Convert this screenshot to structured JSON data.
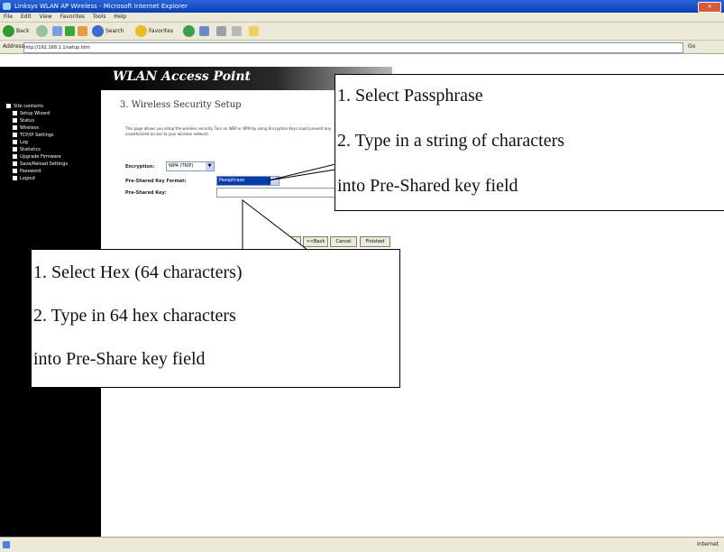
{
  "window": {
    "title": "Linksys WLAN AP Wireless - Microsoft Internet Explorer"
  },
  "menu": {
    "items": [
      "File",
      "Edit",
      "View",
      "Favorites",
      "Tools",
      "Help"
    ]
  },
  "toolbar": {
    "back": "Back",
    "search": "Search",
    "favorites": "Favorites"
  },
  "address": {
    "label": "Address",
    "url": "http://192.168.1.1/setup.htm",
    "go": "Go"
  },
  "header": {
    "title": "WLAN Access Point"
  },
  "nav": {
    "root": "Site contents",
    "items": [
      "Setup Wizard",
      "Status",
      "Wireless",
      "TCP/IP Settings",
      "Log",
      "Statistics",
      "Upgrade Firmware",
      "Save/Reload Settings",
      "Password",
      "Logout"
    ]
  },
  "section": {
    "title": "3. Wireless Security Setup"
  },
  "description": "This page allows you setup the wireless security. Turn on WEP or WPA by using Encryption Keys could prevent any unauthorized access to your wireless network.",
  "form": {
    "encryption_label": "Encryption:",
    "encryption_value": "WPA (TKIP)",
    "psk_format_label": "Pre-Shared Key Format:",
    "psk_format_value": "Passphrase",
    "psk_label": "Pre-Shared Key:"
  },
  "buttons": {
    "cancel": "Cancel",
    "back": "<<Back",
    "finish": "Finished"
  },
  "callouts": {
    "passphrase": {
      "line1": "1. Select Passphrase",
      "line2": "2. Type in a string of characters",
      "line3": "into Pre-Shared key field"
    },
    "hex": {
      "line1": "1. Select Hex (64 characters)",
      "line2": "2. Type in 64 hex characters",
      "line3": "into Pre-Share key field"
    }
  },
  "status": {
    "zone": "Internet"
  },
  "colors": {
    "left_panel": "#000000",
    "title_bar": "#0a3fb4",
    "highlight": "#0a3ca8"
  }
}
